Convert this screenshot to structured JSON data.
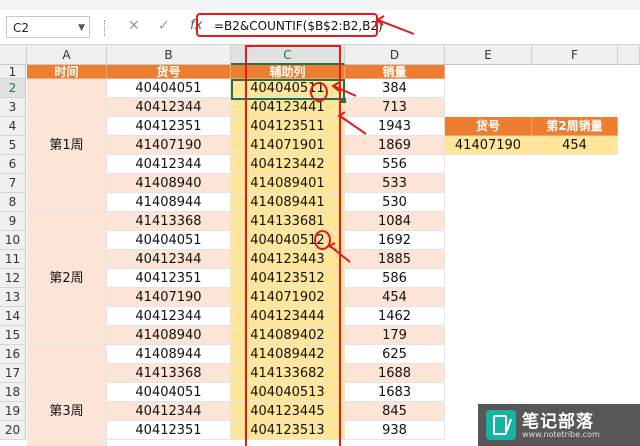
{
  "name_box": "C2",
  "formula": "=B2&COUNTIF($B$2:B2,B2)",
  "fx_label": "fx",
  "columns": [
    "A",
    "B",
    "C",
    "D",
    "E",
    "F"
  ],
  "rows": [
    "1",
    "2",
    "3",
    "4",
    "5",
    "6",
    "7",
    "8",
    "9",
    "10",
    "11",
    "12",
    "13",
    "14",
    "15",
    "16",
    "17",
    "18",
    "19",
    "20"
  ],
  "header": {
    "time": "时间",
    "item": "货号",
    "helper": "辅助列",
    "sales": "销量"
  },
  "weeks": [
    "第1周",
    "第2周",
    "第3周"
  ],
  "data": [
    [
      "40404051",
      "404040511",
      "384"
    ],
    [
      "40412344",
      "404123441",
      "713"
    ],
    [
      "40412351",
      "404123511",
      "1943"
    ],
    [
      "41407190",
      "414071901",
      "1869"
    ],
    [
      "40412344",
      "404123442",
      "556"
    ],
    [
      "41408940",
      "414089401",
      "533"
    ],
    [
      "41408944",
      "414089441",
      "530"
    ],
    [
      "41413368",
      "414133681",
      "1084"
    ],
    [
      "40404051",
      "404040512",
      "1692"
    ],
    [
      "40412344",
      "404123443",
      "1885"
    ],
    [
      "40412351",
      "404123512",
      "586"
    ],
    [
      "41407190",
      "414071902",
      "454"
    ],
    [
      "40412344",
      "404123444",
      "1462"
    ],
    [
      "41408940",
      "414089402",
      "179"
    ],
    [
      "41408944",
      "414089442",
      "625"
    ],
    [
      "41413368",
      "414133682",
      "1688"
    ],
    [
      "40404051",
      "404040513",
      "1683"
    ],
    [
      "40412344",
      "404123445",
      "845"
    ],
    [
      "40412351",
      "404123513",
      "938"
    ]
  ],
  "lookup": {
    "header_item": "货号",
    "header_sales": "第2周销量",
    "item": "41407190",
    "sales": "454"
  },
  "watermark": {
    "title": "笔记部落",
    "url": "www.notetribe.com"
  },
  "colors": {
    "header_orange": "#ed7d31",
    "pink": "#fce4d6",
    "yellow": "#ffe699",
    "annotation_red": "#e11a1a",
    "excel_green": "#217346"
  }
}
